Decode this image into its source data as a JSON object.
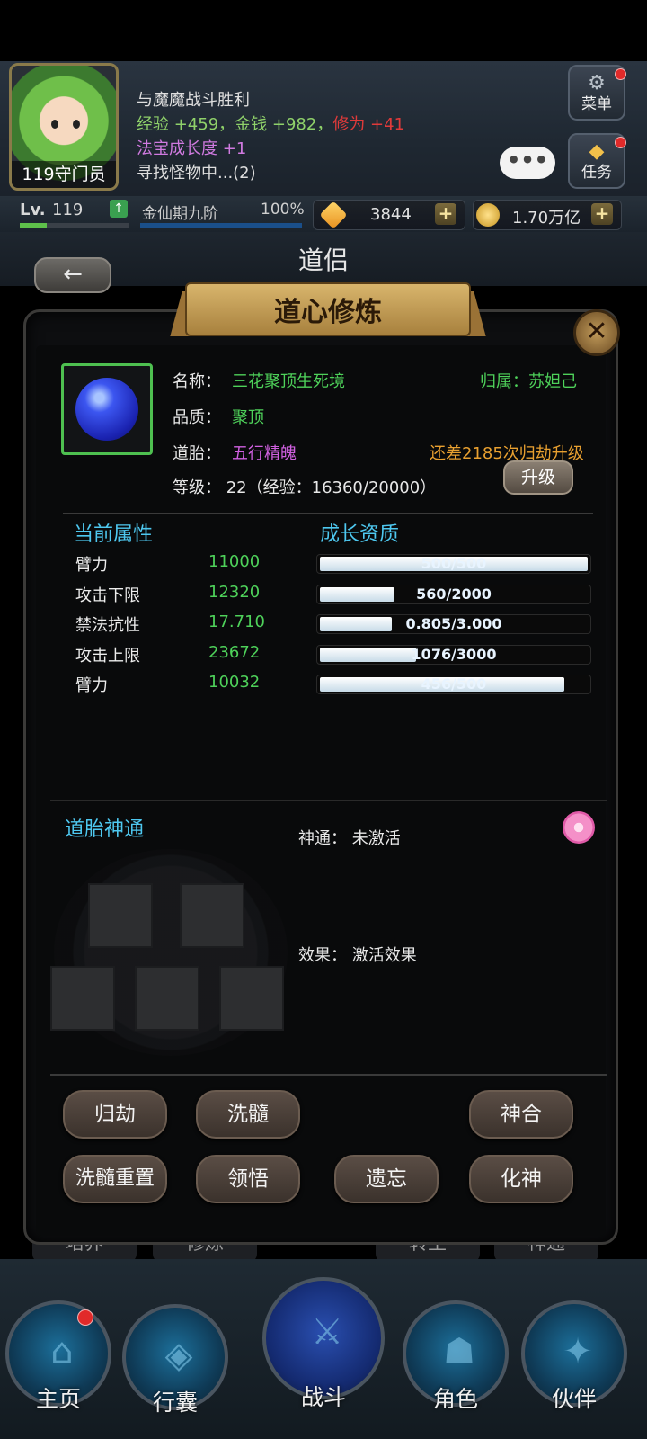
{
  "header": {
    "avatar_label": "119守门员",
    "log": [
      {
        "text": "与魔魔战斗胜利"
      },
      {
        "parts": [
          "经验 +459，金钱 +982，",
          "修为 +41"
        ]
      },
      {
        "parts": [
          "法宝成长度 ",
          "+1"
        ]
      },
      {
        "text": "寻找怪物中...(2)"
      }
    ],
    "menu_label": "菜单",
    "task_label": "任务",
    "chat_dots": "•••"
  },
  "stats": {
    "lv_tag": "Lv.",
    "level": "119",
    "level_up_icon": "level-up-arrow",
    "realm": "金仙期九阶",
    "realm_percent": "100%",
    "gems": "3844",
    "gold": "1.70万亿",
    "plus": "+"
  },
  "page": {
    "back_icon": "←",
    "title": "道侣",
    "banner_title": "道心修炼",
    "close_icon": "✕"
  },
  "item": {
    "name_label": "名称：",
    "name": "三花聚顶生死境",
    "owner": "归属：苏妲己",
    "quality_label": "品质：",
    "quality": "聚顶",
    "embryo_label": "道胎：",
    "embryo": "五行精魄",
    "need": "还差2185次归劫升级",
    "level_line": "等级：  22（经验：16360/20000）",
    "upgrade_label": "升级"
  },
  "attributes": {
    "current_header": "当前属性",
    "growth_header": "成长资质",
    "rows": [
      {
        "name": "臂力",
        "value": "11000",
        "growth": "500/500",
        "fill": 1.0
      },
      {
        "name": "攻击下限",
        "value": "12320",
        "growth": "560/2000",
        "fill": 0.28
      },
      {
        "name": "禁法抗性",
        "value": "17.710",
        "growth": "0.805/3.000",
        "fill": 0.268
      },
      {
        "name": "攻击上限",
        "value": "23672",
        "growth": "1076/3000",
        "fill": 0.359
      },
      {
        "name": "臂力",
        "value": "10032",
        "growth": "456/500",
        "fill": 0.912
      }
    ]
  },
  "divine": {
    "header": "道胎神通",
    "shentong_label": "神通：  未激活",
    "effect_label": "效果：  激活效果",
    "flower_icon": "lotus-flower-icon"
  },
  "buttons": {
    "guijie": "归劫",
    "xisui": "洗髓",
    "shenhe": "神合",
    "xisui_reset": "洗髓重置",
    "lingwu": "领悟",
    "yiwang": "遗忘",
    "huashen": "化神"
  },
  "subtabs": [
    "培养",
    "修炼",
    "转生",
    "神通"
  ],
  "nav": {
    "home": "主页",
    "bag": "行囊",
    "battle": "战斗",
    "role": "角色",
    "partner": "伙伴"
  },
  "colors": {
    "green_text": "#4ed15a",
    "purple_text": "#d060e0",
    "orange_text": "#e8a030",
    "section_blue": "#4ec8f0"
  }
}
